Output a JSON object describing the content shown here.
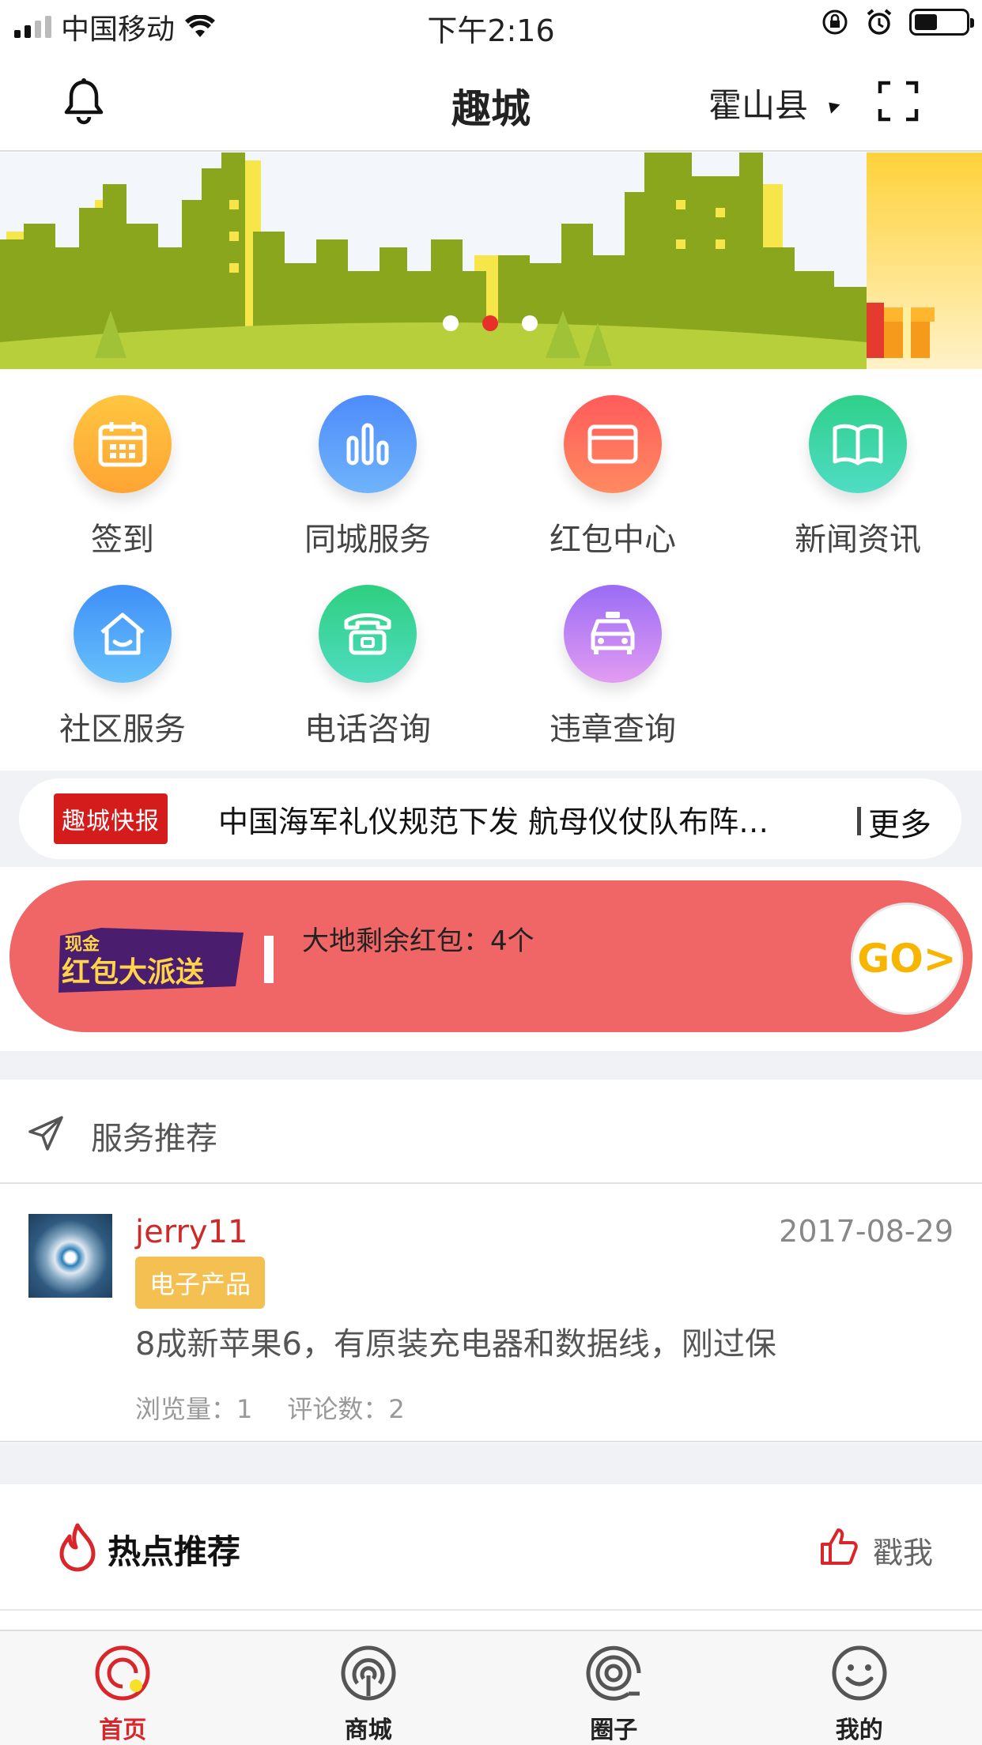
{
  "status_bar": {
    "carrier": "中国移动",
    "time": "下午2:16"
  },
  "nav": {
    "title": "趣城",
    "city": "霍山县"
  },
  "banner": {
    "page_count": 3,
    "active_index": 1
  },
  "quick_menu": [
    {
      "label": "签到",
      "icon": "calendar-icon",
      "color": "#ffb43a"
    },
    {
      "label": "同城服务",
      "icon": "bar-chart-icon",
      "color": "#5c9dfb"
    },
    {
      "label": "红包中心",
      "icon": "wallet-icon",
      "color": "#ff6a5c"
    },
    {
      "label": "新闻资讯",
      "icon": "book-icon",
      "color": "#35d4a0"
    },
    {
      "label": "社区服务",
      "icon": "house-icon",
      "color": "#4fa8f8"
    },
    {
      "label": "电话咨询",
      "icon": "telephone-icon",
      "color": "#34d38d"
    },
    {
      "label": "违章查询",
      "icon": "car-icon",
      "color": "#b46cf2"
    }
  ],
  "news_ticker": {
    "tag": "趣城快报",
    "headline": "中国海军礼仪规范下发 航母仪仗队布阵…",
    "more": "更多"
  },
  "red_packet": {
    "logo_line1": "现金",
    "logo_line2": "红包大派送",
    "message": "大地剩余红包：4个",
    "go": "GO>"
  },
  "service_recommend": {
    "title": "服务推荐",
    "post": {
      "username": "jerry11",
      "date": "2017-08-29",
      "category": "电子产品",
      "description": "8成新苹果6，有原装充电器和数据线，刚过保",
      "views_label": "浏览量：1",
      "comments_label": "评论数：2"
    }
  },
  "hot_recommend": {
    "title": "热点推荐",
    "action": "戳我"
  },
  "tab_bar": [
    {
      "label": "首页",
      "active": true
    },
    {
      "label": "商城",
      "active": false
    },
    {
      "label": "圈子",
      "active": false
    },
    {
      "label": "我的",
      "active": false
    }
  ],
  "colors": {
    "brand_red": "#d9262a",
    "red_packet_bg": "#f06565",
    "category_badge": "#f4c052"
  }
}
